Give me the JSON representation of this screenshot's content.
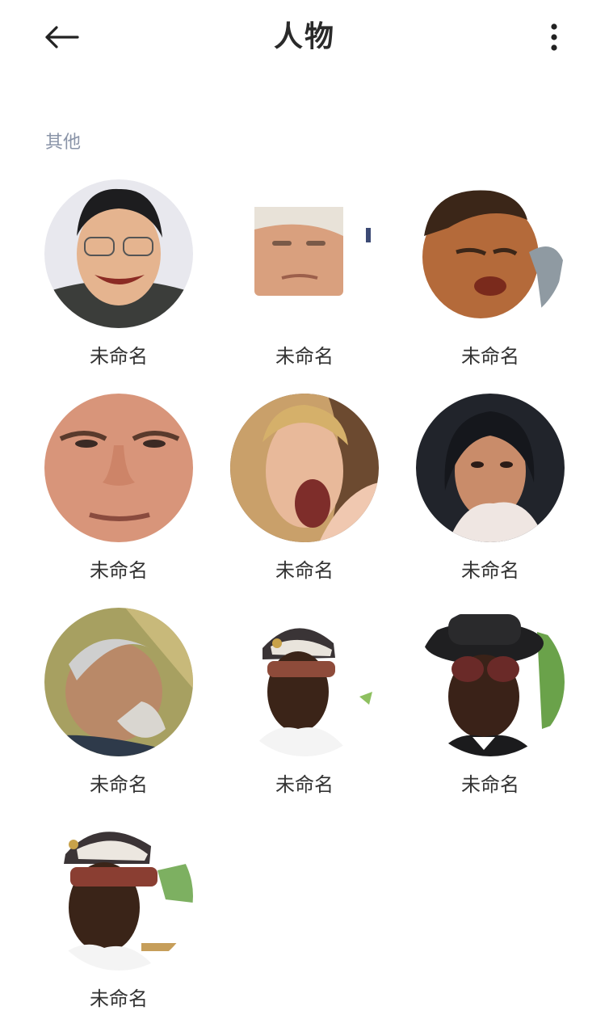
{
  "header": {
    "title": "人物"
  },
  "section": {
    "label": "其他"
  },
  "people": [
    {
      "name": "未命名"
    },
    {
      "name": "未命名"
    },
    {
      "name": "未命名"
    },
    {
      "name": "未命名"
    },
    {
      "name": "未命名"
    },
    {
      "name": "未命名"
    },
    {
      "name": "未命名"
    },
    {
      "name": "未命名"
    },
    {
      "name": "未命名"
    },
    {
      "name": "未命名"
    }
  ],
  "icons": {
    "back": "back-arrow-icon",
    "more": "more-vertical-icon"
  }
}
